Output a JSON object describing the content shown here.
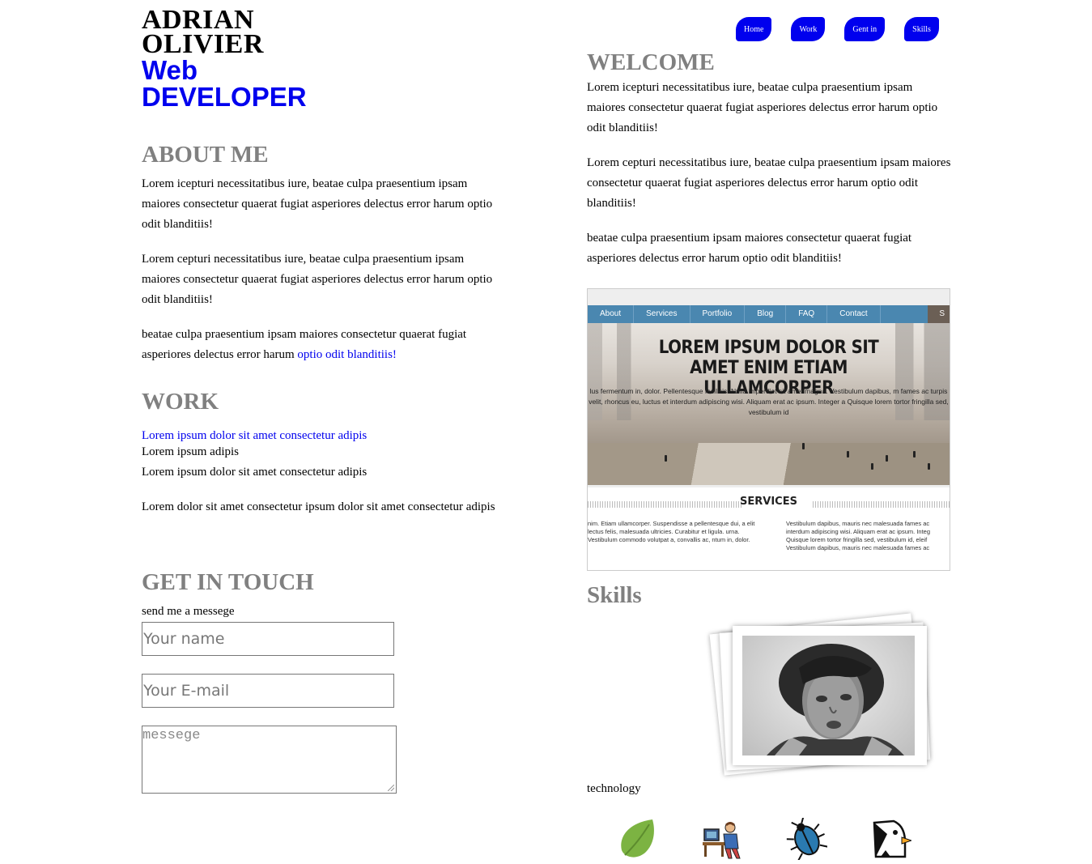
{
  "header": {
    "name_line1": "ADRIAN",
    "name_line2": "OLIVIER",
    "role_line1": "Web",
    "role_line2": "DEVELOPER"
  },
  "nav": {
    "items": [
      "Home",
      "Work",
      "Gent in",
      "Skills"
    ]
  },
  "about": {
    "title": "ABOUT ME",
    "p1": "Lorem icepturi necessitatibus iure, beatae culpa praesentium ipsam maiores consectetur quaerat fugiat asperiores delectus error harum optio odit blanditiis!",
    "p2": "Lorem cepturi necessitatibus iure, beatae culpa praesentium ipsam maiores consectetur quaerat fugiat asperiores delectus error harum optio odit blanditiis!",
    "p3_text": "beatae culpa praesentium ipsam maiores consectetur quaerat fugiat asperiores delectus error harum ",
    "p3_link": "optio odit blanditiis!"
  },
  "work": {
    "title": "WORK",
    "link": "Lorem ipsum dolor sit amet consectetur adipis",
    "line2": "Lorem ipsum adipis",
    "line3": "Lorem ipsum dolor sit amet consectetur adipis",
    "p": "Lorem dolor sit amet consectetur ipsum dolor sit amet consectetur adipis"
  },
  "contact": {
    "title": "GET IN TOUCH",
    "subtitle": "send me a messege",
    "name_placeholder": "Your name",
    "email_placeholder": "Your E-mail",
    "message_placeholder": "messege"
  },
  "welcome": {
    "title": "WELCOME",
    "p1": "Lorem icepturi necessitatibus iure, beatae culpa praesentium ipsam maiores consectetur quaerat fugiat asperiores delectus error harum optio odit blanditiis!",
    "p2": "Lorem cepturi necessitatibus iure, beatae culpa praesentium ipsam maiores consectetur quaerat fugiat asperiores delectus error harum optio odit blanditiis!",
    "p3": "beatae culpa praesentium ipsam maiores consectetur quaerat fugiat asperiores delectus error harum optio odit blanditiis!"
  },
  "preview": {
    "menu": [
      "About",
      "Services",
      "Portfolio",
      "Blog",
      "FAQ",
      "Contact",
      "S"
    ],
    "headline": "LOREM IPSUM DOLOR SIT AMET ENIM ETIAM ULLAMCORPER",
    "small_text": "lus fermentum in, dolor. Pellentesque facilisis. Nulla imperdiet sit amet magna. Vestibulum dapibus, m fames ac turpis velit, rhoncus eu, luctus et interdum adipiscing wisi. Aliquam erat ac ipsum. Integer a Quisque lorem tortor fringilla sed, vestibulum id",
    "services_title": "SERVICES",
    "col1": "nim. Etiam ullamcorper. Suspendisse a pellentesque dui, a elit lectus felis, malesuada ultricies. Curabitur et ligula. urna. Vestibulum commodo volutpat a, convallis ac, ntum in, dolor.",
    "col2": "Vestibulum dapibus, mauris nec malesuada fames ac interdum adipiscing wisi. Aliquam erat ac ipsum. Integ Quisque lorem tortor fringilla sed, vestibulum id, eleif Vestibulum dapibus, mauris nec malesuada fames ac"
  },
  "skills": {
    "title": "Skills",
    "technology_label": "technology",
    "icons": [
      "envato-leaf-icon",
      "workstation-person-icon",
      "beetle-icon",
      "penguin-icon"
    ]
  },
  "colors": {
    "link": "#0000ee",
    "heading_gray": "#808080",
    "nav_bg": "#0000ee",
    "preview_menu": "#4a87b0",
    "leaf_green": "#7cb342"
  }
}
